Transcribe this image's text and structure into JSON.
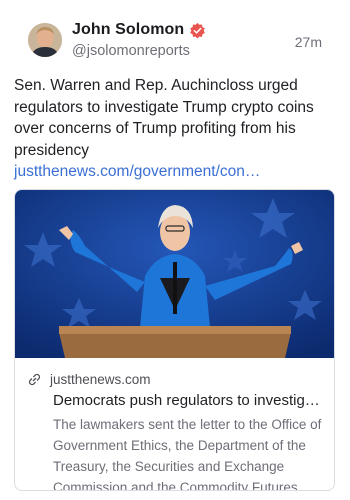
{
  "post": {
    "author": {
      "display_name": "John Solomon",
      "handle": "@jsolomonreports",
      "verified": true,
      "avatar_icon": "avatar-photo"
    },
    "timestamp": "27m",
    "text": "Sen. Warren and Rep. Auchincloss urged regulators to investigate Trump crypto coins over concerns of Trump profiting from his presidency ",
    "link_text": "justthenews.com/government/con…",
    "link_card": {
      "domain": "justthenews.com",
      "title": "Democrats push regulators to investig…",
      "description": "The lawmakers sent the letter to the Office of Government Ethics, the Department of the Treasury, the Securities and Exchange Commission and the Commodity Futures Tr…",
      "image_icon": "speaker-at-podium-photo"
    }
  },
  "colors": {
    "verified_badge": "#e8544f",
    "link": "#3b6fd4",
    "image_background": "#123a8c"
  }
}
